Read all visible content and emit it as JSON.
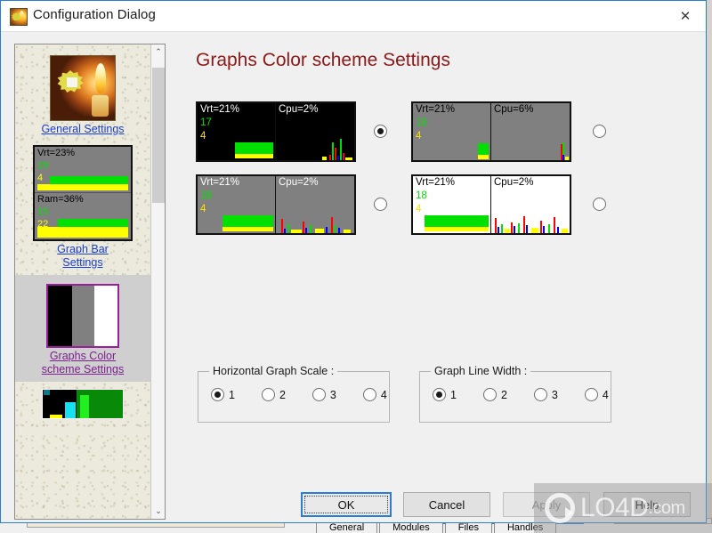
{
  "window": {
    "title": "Configuration Dialog",
    "icon": "candle-gear-icon",
    "close_label": "✕"
  },
  "content": {
    "heading": "Graphs Color scheme Settings",
    "heading_color": "#8b1a1a"
  },
  "sidebar": {
    "scroll_up": "⌃",
    "scroll_down": "⌄",
    "items": [
      {
        "label": "General Settings",
        "thumb": "candle-icon",
        "selected": false
      },
      {
        "label_line1": "Graph Bar",
        "label_line2": "Settings",
        "thumb": "graph-bar-preview",
        "selected": false,
        "preview": {
          "panels": [
            {
              "title": "Vrt=23%",
              "n1": "19",
              "n2": "4"
            },
            {
              "title": "Ram=36%",
              "n1": "15",
              "n2": "22"
            }
          ]
        }
      },
      {
        "label_line1": "Graphs Color",
        "label_line2": "scheme Settings",
        "thumb": "color-swatch-preview",
        "selected": true,
        "swatches": [
          "#000000",
          "#808080",
          "#ffffff"
        ],
        "border_color": "#9b1f9b"
      },
      {
        "label": "",
        "thumb": "bar-chart-preview",
        "selected": false
      }
    ]
  },
  "color_schemes": {
    "selected_index": 0,
    "options": [
      {
        "name": "black-scheme",
        "bg": "#000000",
        "title_color": "#ffffff",
        "vrt_title": "Vrt=21%",
        "vrt_n1": "17",
        "vrt_n2": "4",
        "cpu_title": "Cpu=2%",
        "selected": true
      },
      {
        "name": "gray-dark-text-scheme",
        "bg": "#808080",
        "title_color": "#000000",
        "vrt_title": "Vrt=21%",
        "vrt_n1": "18",
        "vrt_n2": "4",
        "cpu_title": "Cpu=6%",
        "selected": false
      },
      {
        "name": "gray-light-text-scheme",
        "bg": "#808080",
        "title_color": "#ffffff",
        "vrt_title": "Vrt=21%",
        "vrt_n1": "18",
        "vrt_n2": "4",
        "cpu_title": "Cpu=2%",
        "selected": false
      },
      {
        "name": "white-scheme",
        "bg": "#ffffff",
        "title_color": "#000000",
        "vrt_title": "Vrt=21%",
        "vrt_n1": "18",
        "vrt_n2": "4",
        "cpu_title": "Cpu=2%",
        "selected": false
      }
    ]
  },
  "horizontal_graph_scale": {
    "title": "Horizontal Graph Scale :",
    "options": [
      "1",
      "2",
      "3",
      "4"
    ],
    "selected": "1"
  },
  "graph_line_width": {
    "title": "Graph Line Width :",
    "options": [
      "1",
      "2",
      "3",
      "4"
    ],
    "selected": "1"
  },
  "buttons": {
    "ok": "OK",
    "cancel": "Cancel",
    "apply": "Apply",
    "apply_disabled": true,
    "help": "Help"
  },
  "watermark": {
    "text": "LO4D",
    "suffix": ".com"
  },
  "background_window": {
    "tabs": [
      "General",
      "Modules",
      "Files",
      "Handles"
    ]
  }
}
